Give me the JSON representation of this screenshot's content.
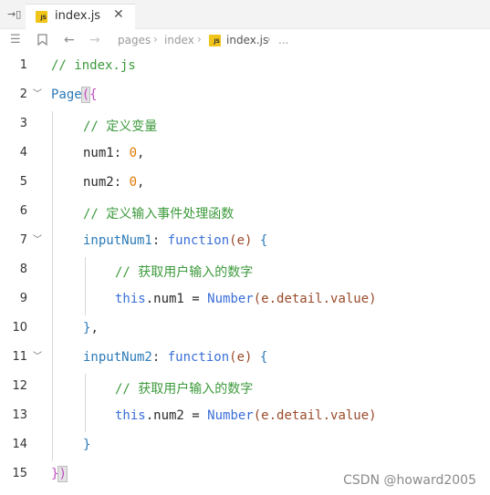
{
  "tab": {
    "filename": "index.js",
    "badge": "JS"
  },
  "breadcrumb": {
    "items": [
      "pages",
      "index",
      "index.js",
      "..."
    ]
  },
  "lines": [
    {
      "n": "1"
    },
    {
      "n": "2"
    },
    {
      "n": "3"
    },
    {
      "n": "4"
    },
    {
      "n": "5"
    },
    {
      "n": "6"
    },
    {
      "n": "7"
    },
    {
      "n": "8"
    },
    {
      "n": "9"
    },
    {
      "n": "10"
    },
    {
      "n": "11"
    },
    {
      "n": "12"
    },
    {
      "n": "13"
    },
    {
      "n": "14"
    },
    {
      "n": "15"
    }
  ],
  "code": {
    "l1_comment": "// index.js",
    "l2_page": "Page",
    "l2_paren": "(",
    "l2_brace": "{",
    "l3_comment": "// 定义变量",
    "l4_key": "num1",
    "l4_colon": ": ",
    "l4_val": "0",
    "l4_comma": ",",
    "l5_key": "num2",
    "l5_colon": ": ",
    "l5_val": "0",
    "l5_comma": ",",
    "l6_comment": "// 定义输入事件处理函数",
    "l7_key": "inputNum1",
    "l7_colon": ": ",
    "l7_fn": "function",
    "l7_open": "(",
    "l7_param": "e",
    "l7_close": ")",
    "l7_brace": " {",
    "l8_comment": "// 获取用户输入的数字",
    "l9_this": "this",
    "l9_prop": ".num1 = ",
    "l9_number": "Number",
    "l9_args": "(e.detail.value)",
    "l10_close": "}",
    "l10_comma": ",",
    "l11_key": "inputNum2",
    "l11_colon": ": ",
    "l11_fn": "function",
    "l11_open": "(",
    "l11_param": "e",
    "l11_close": ")",
    "l11_brace": " {",
    "l12_comment": "// 获取用户输入的数字",
    "l13_this": "this",
    "l13_prop": ".num2 = ",
    "l13_number": "Number",
    "l13_args": "(e.detail.value)",
    "l14_close": "}",
    "l15_brace": "}",
    "l15_paren": ")"
  },
  "watermark": "CSDN @howard2005",
  "colors": {
    "comment": "#3c9a3c",
    "keyword": "#3a6fd8",
    "number": "#e07a00",
    "brace": "#c04cc0"
  }
}
